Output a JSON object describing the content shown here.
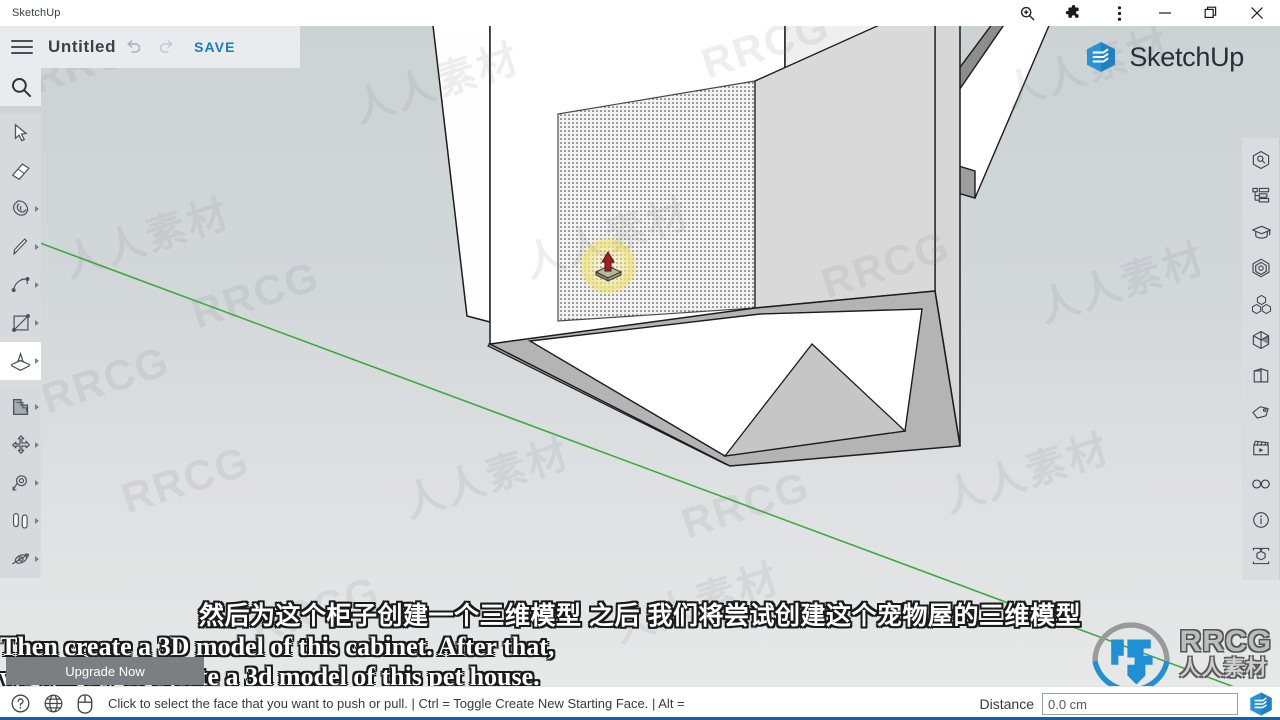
{
  "browser": {
    "tab_title": "SketchUp",
    "controls": [
      {
        "name": "zoom-icon",
        "label": "Zoom"
      },
      {
        "name": "extensions-icon",
        "label": "Extensions"
      },
      {
        "name": "browser-menu-icon",
        "label": "Menu"
      },
      {
        "name": "minimize-icon",
        "label": "Minimize"
      },
      {
        "name": "maximize-icon",
        "label": "Maximize"
      },
      {
        "name": "close-icon",
        "label": "Close"
      }
    ]
  },
  "header": {
    "menu_label": "Menu",
    "document_title": "Untitled",
    "undo_label": "Undo",
    "redo_label": "Redo",
    "save_label": "SAVE"
  },
  "brand": {
    "name": "SketchUp"
  },
  "left_toolbar": {
    "search": {
      "label": "Search",
      "icon": "search-icon"
    },
    "tools": [
      {
        "label": "Select",
        "icon": "select-arrow-icon",
        "flyout": false,
        "active": false
      },
      {
        "label": "Eraser",
        "icon": "eraser-icon",
        "flyout": false,
        "active": false
      },
      {
        "label": "Paint Bucket",
        "icon": "paint-bucket-icon",
        "flyout": true,
        "active": false
      },
      {
        "label": "Line",
        "icon": "pencil-line-icon",
        "flyout": true,
        "active": false
      },
      {
        "label": "Arc",
        "icon": "arc-icon",
        "flyout": true,
        "active": false
      },
      {
        "label": "Rectangle",
        "icon": "rectangle-icon",
        "flyout": true,
        "active": false
      },
      {
        "label": "Push/Pull",
        "icon": "push-pull-icon",
        "flyout": true,
        "active": true
      },
      {
        "label": "Offset",
        "icon": "offset-icon",
        "flyout": true,
        "active": false
      },
      {
        "label": "Move",
        "icon": "move-icon",
        "flyout": true,
        "active": false
      },
      {
        "label": "Orbit",
        "icon": "orbit-icon",
        "flyout": true,
        "active": false
      },
      {
        "label": "Walk",
        "icon": "walk-icon",
        "flyout": true,
        "active": false
      },
      {
        "label": "Rotate",
        "icon": "rotate-icon",
        "flyout": true,
        "active": false
      }
    ]
  },
  "right_toolbar": {
    "tools": [
      {
        "label": "Model Info",
        "icon": "model-info-cube-icon"
      },
      {
        "label": "Outliner",
        "icon": "outliner-icon"
      },
      {
        "label": "Learn",
        "icon": "graduation-cap-icon"
      },
      {
        "label": "Materials",
        "icon": "materials-icon"
      },
      {
        "label": "Components",
        "icon": "components-icon"
      },
      {
        "label": "Styles",
        "icon": "styles-cube-icon"
      },
      {
        "label": "Display",
        "icon": "display-cube-icon"
      },
      {
        "label": "Tags",
        "icon": "tag-icon"
      },
      {
        "label": "Scenes",
        "icon": "scenes-clapper-icon"
      },
      {
        "label": "Stereo View",
        "icon": "glasses-icon"
      },
      {
        "label": "Entity Info",
        "icon": "info-circle-icon"
      },
      {
        "label": "Export",
        "icon": "export-box-icon"
      }
    ]
  },
  "upgrade": {
    "label": "Upgrade Now"
  },
  "statusbar": {
    "icons": [
      {
        "label": "Help",
        "icon": "help-circle-icon"
      },
      {
        "label": "Language",
        "icon": "globe-icon"
      },
      {
        "label": "Mouse Tips",
        "icon": "mouse-icon"
      }
    ],
    "message": "Click to select the face that you want to push or pull. | Ctrl = Toggle Create New Starting Face. | Alt =",
    "measure_label": "Distance",
    "measure_value": "0.0 cm",
    "measure_placeholder": "0.0 cm",
    "logo": "sketchup-logo-icon"
  },
  "subtitles": {
    "chinese": "然后为这个柜子创建一个三维模型 之后 我们将尝试创建这个宠物屋的三维模型",
    "english_line1": "Then create a 3D model of this cabinet. After that,",
    "english_line2": "we will try to create a 3d model of this pet house."
  },
  "watermark": {
    "brand_en": "RRCG",
    "brand_cn": "人人素材",
    "tiles": [
      "RRCG",
      "人人素材"
    ]
  },
  "colors": {
    "accent_blue": "#1a7bbd",
    "brand_blue": "#2a93d5",
    "header_bg": "#e8ecef",
    "toolbar_bg": "#d6dadc",
    "panel_bg": "#d9dde0",
    "green_axis": "#3fa93f",
    "upgrade_bg": "#7a7f84",
    "status_blue": "#1560a8",
    "face_light": "#ffffff",
    "face_mid": "#e8e8e8",
    "face_shadow": "#a8a8a8",
    "face_dark": "#909090",
    "cursor_red": "#9e2020",
    "highlight_yellow": "#f5efa8"
  },
  "scene": {
    "tool_cursor": "push-pull-cursor",
    "selected_face": "dotted-highlight-face",
    "axis_green_label": "green-axis"
  }
}
